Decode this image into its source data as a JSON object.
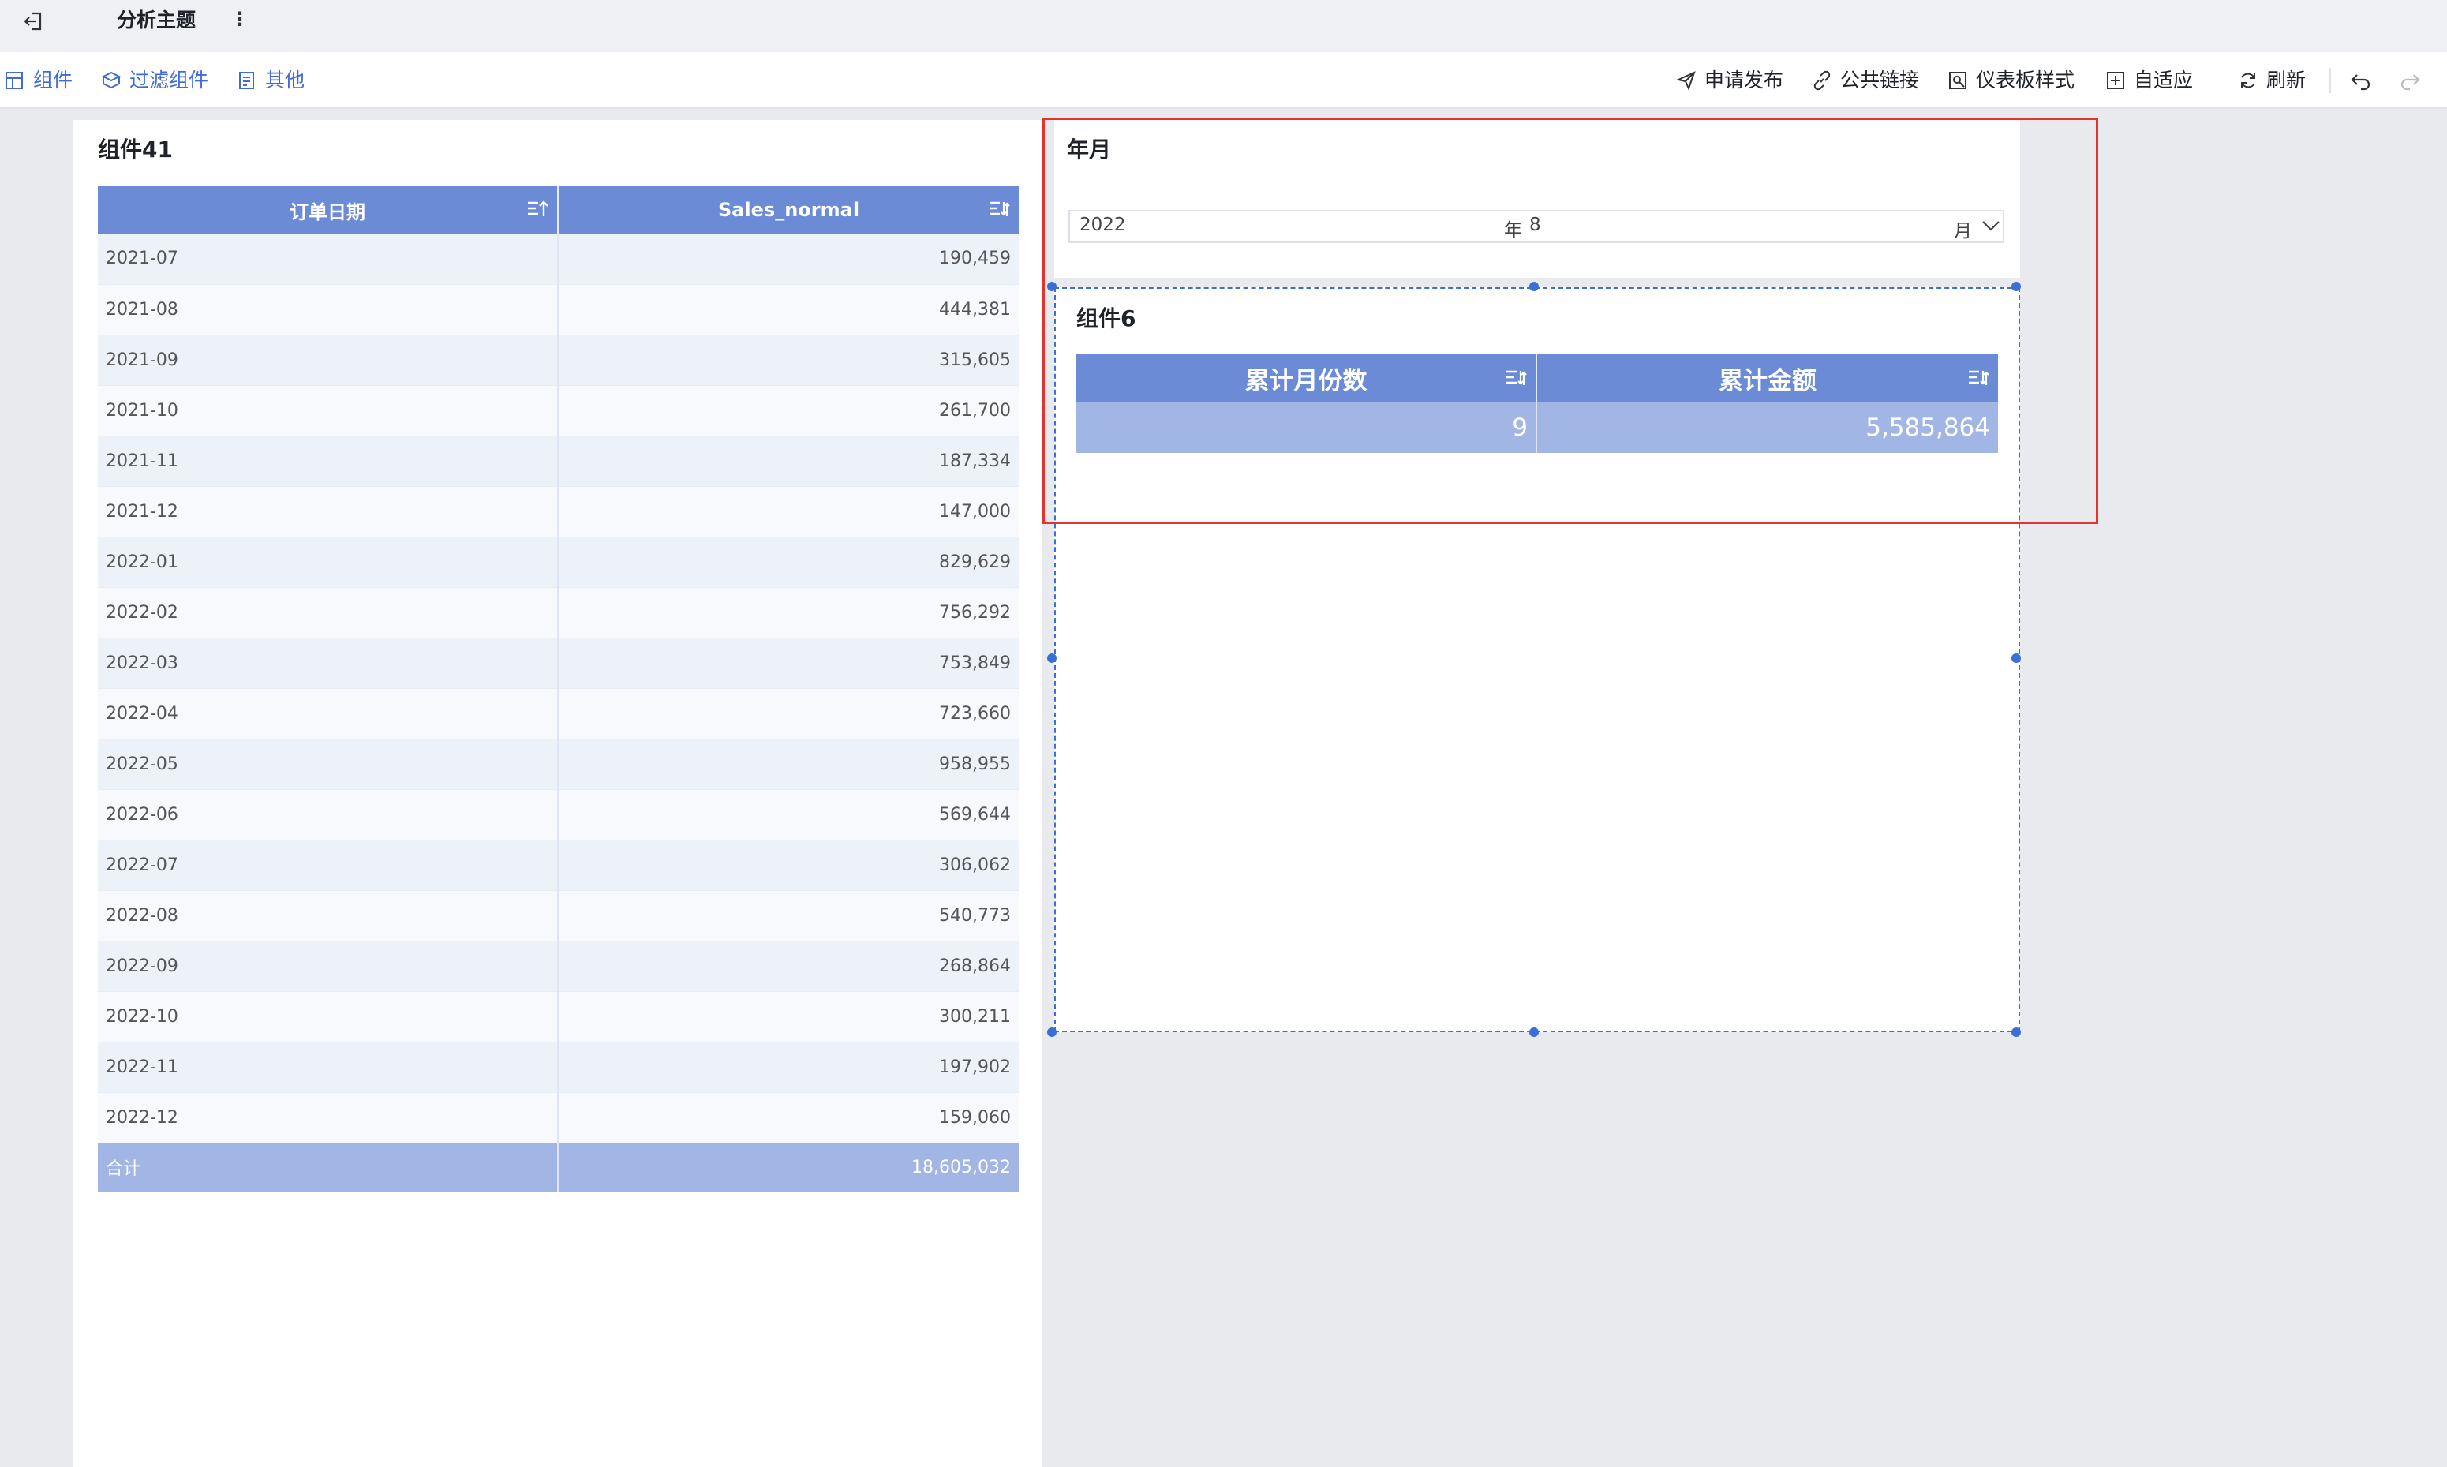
{
  "header": {
    "title": "分析主题",
    "more_symbol": "⋮"
  },
  "toolbar": {
    "left": [
      {
        "label": "组件",
        "icon": "add-widget-icon"
      },
      {
        "label": "过滤组件",
        "icon": "filter-widget-icon"
      },
      {
        "label": "其他",
        "icon": "other-icon"
      }
    ],
    "right": [
      {
        "label": "申请发布",
        "icon": "send-icon"
      },
      {
        "label": "公共链接",
        "icon": "link-icon"
      },
      {
        "label": "仪表板样式",
        "icon": "dashboard-style-icon"
      },
      {
        "label": "自适应",
        "icon": "fit-icon"
      },
      {
        "label": "刷新",
        "icon": "refresh-icon"
      }
    ]
  },
  "widget41": {
    "title": "组件41",
    "columns": [
      "订单日期",
      "Sales_normal"
    ],
    "rows": [
      [
        "2021-07",
        "190,459"
      ],
      [
        "2021-08",
        "444,381"
      ],
      [
        "2021-09",
        "315,605"
      ],
      [
        "2021-10",
        "261,700"
      ],
      [
        "2021-11",
        "187,334"
      ],
      [
        "2021-12",
        "147,000"
      ],
      [
        "2022-01",
        "829,629"
      ],
      [
        "2022-02",
        "756,292"
      ],
      [
        "2022-03",
        "753,849"
      ],
      [
        "2022-04",
        "723,660"
      ],
      [
        "2022-05",
        "958,955"
      ],
      [
        "2022-06",
        "569,644"
      ],
      [
        "2022-07",
        "306,062"
      ],
      [
        "2022-08",
        "540,773"
      ],
      [
        "2022-09",
        "268,864"
      ],
      [
        "2022-10",
        "300,211"
      ],
      [
        "2022-11",
        "197,902"
      ],
      [
        "2022-12",
        "159,060"
      ]
    ],
    "total": [
      "合计",
      "18,605,032"
    ]
  },
  "filter": {
    "title": "年月",
    "year_value": "2022",
    "year_unit": "年",
    "month_value": "8",
    "month_unit": "月"
  },
  "widget6": {
    "title": "组件6",
    "columns": [
      "累计月份数",
      "累计金额"
    ],
    "values": [
      "9",
      "5,585,864"
    ]
  },
  "colors": {
    "accent": "#3f6ad8",
    "header_bg": "#6b8bd6",
    "total_bg": "#a1b6e4",
    "selection_red": "#e5322d"
  }
}
